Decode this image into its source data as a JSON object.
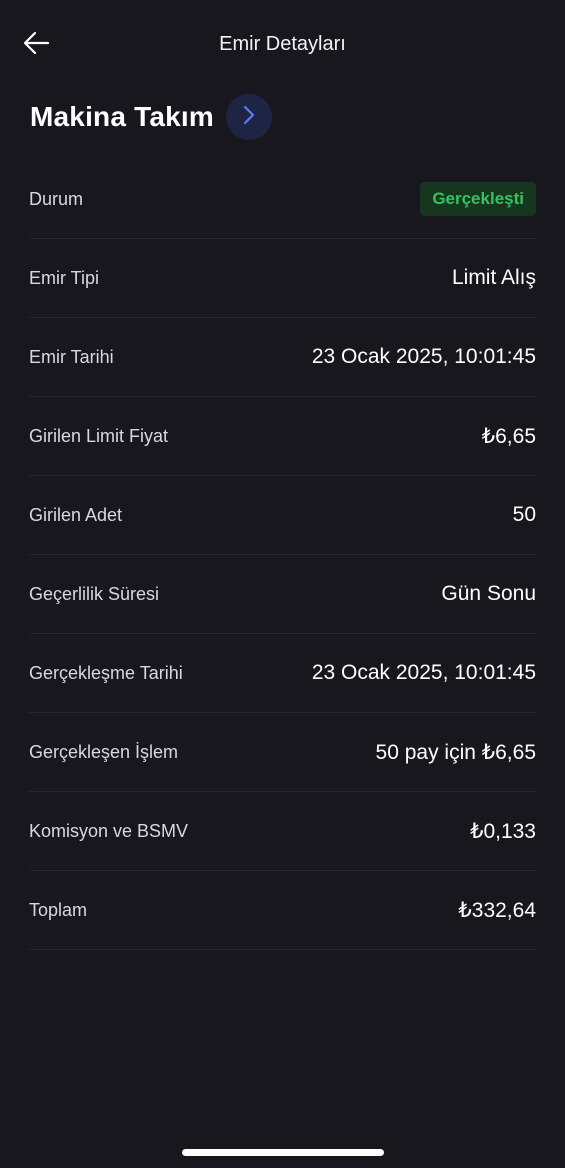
{
  "header": {
    "title": "Emir Detayları",
    "back_icon": "arrow-left-icon"
  },
  "instrument": {
    "name": "Makina Takım",
    "go_icon": "chevron-right-icon",
    "accent": "#5b7cf5"
  },
  "status": {
    "label": "Durum",
    "value": "Gerçekleşti",
    "color": "#35c25f"
  },
  "details": [
    {
      "label": "Emir Tipi",
      "value": "Limit Alış"
    },
    {
      "label": "Emir Tarihi",
      "value": "23 Ocak 2025, 10:01:45"
    },
    {
      "label": "Girilen Limit Fiyat",
      "value": "₺6,65"
    },
    {
      "label": "Girilen Adet",
      "value": "50"
    },
    {
      "label": "Geçerlilik Süresi",
      "value": "Gün Sonu"
    },
    {
      "label": "Gerçekleşme Tarihi",
      "value": "23 Ocak 2025, 10:01:45"
    },
    {
      "label": "Gerçekleşen İşlem",
      "value": "50 pay için ₺6,65"
    },
    {
      "label": "Komisyon ve BSMV",
      "value": "₺0,133"
    },
    {
      "label": "Toplam",
      "value": "₺332,64"
    }
  ]
}
